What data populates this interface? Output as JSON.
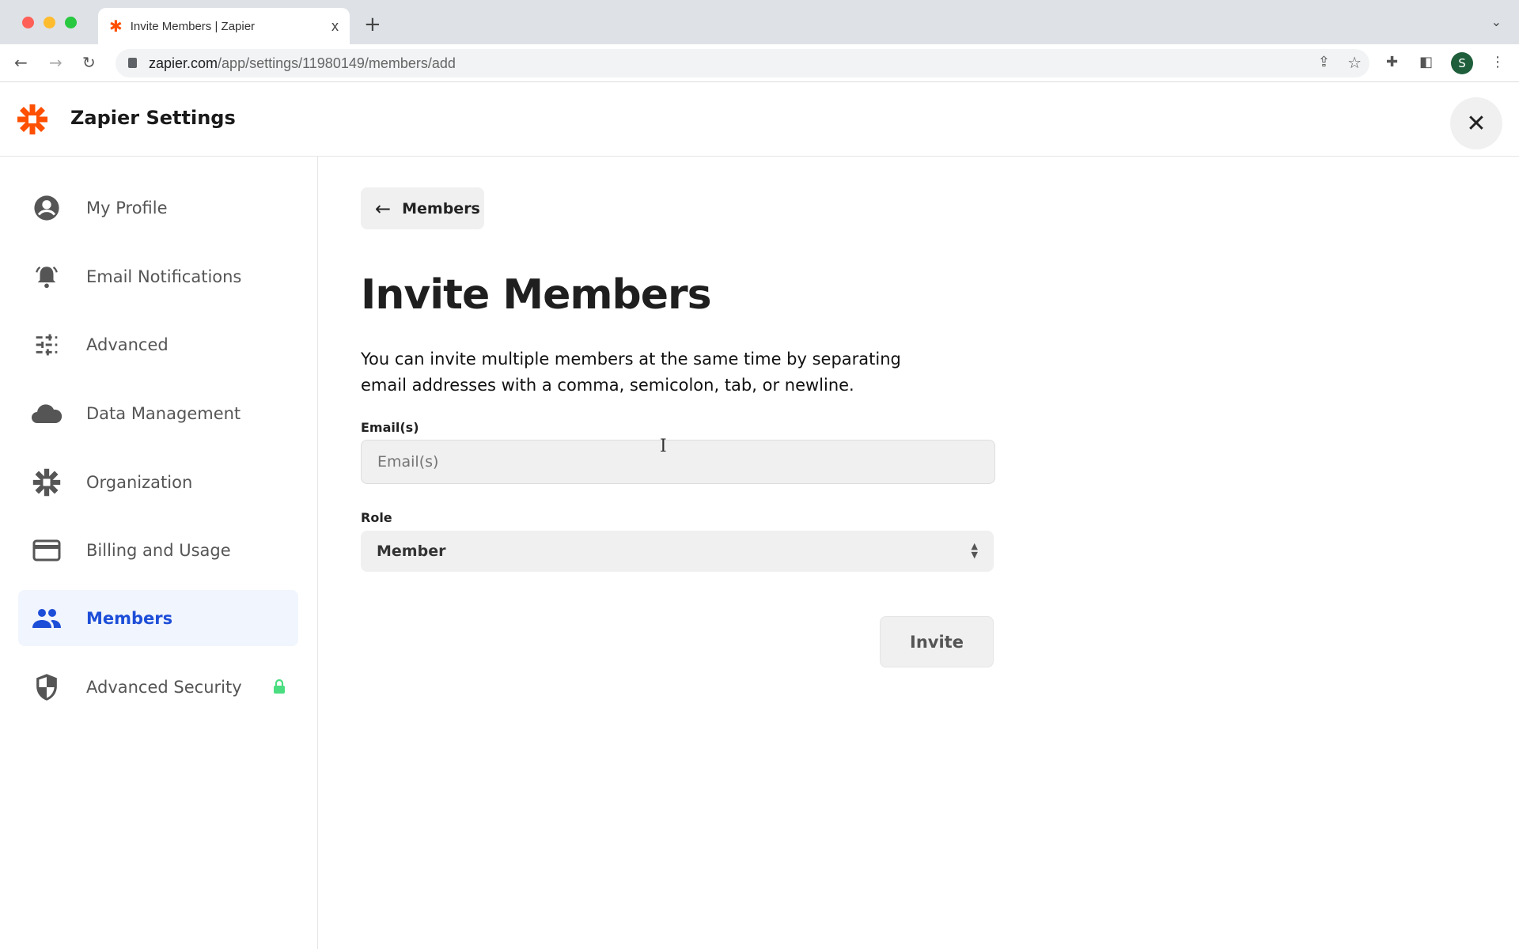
{
  "browser": {
    "tab_title": "Invite Members | Zapier",
    "tab_close": "x",
    "new_tab": "+",
    "url_domain": "zapier.com",
    "url_path": "/app/settings/11980149/members/add",
    "profile_initial": "S"
  },
  "header": {
    "title": "Zapier Settings",
    "close": "✕"
  },
  "sidebar": {
    "items": [
      {
        "label": "My Profile",
        "icon": "user-circle-icon"
      },
      {
        "label": "Email Notifications",
        "icon": "bell-icon"
      },
      {
        "label": "Advanced",
        "icon": "sliders-icon"
      },
      {
        "label": "Data Management",
        "icon": "cloud-icon"
      },
      {
        "label": "Organization",
        "icon": "zapier-asterisk-icon"
      },
      {
        "label": "Billing and Usage",
        "icon": "credit-card-icon"
      },
      {
        "label": "Members",
        "icon": "people-icon",
        "active": true
      },
      {
        "label": "Advanced Security",
        "icon": "shield-icon",
        "locked": true
      }
    ]
  },
  "main": {
    "back_label": "Members",
    "title": "Invite Members",
    "description": "You can invite multiple members at the same time by separating email addresses with a comma, semicolon, tab, or newline.",
    "email_label": "Email(s)",
    "email_placeholder": "Email(s)",
    "email_value": "",
    "role_label": "Role",
    "role_value": "Member",
    "invite_label": "Invite"
  },
  "colors": {
    "brand": "#ff4f00",
    "active": "#1d4ed8",
    "active_bg": "#f1f5fd",
    "lock": "#4ade80"
  }
}
